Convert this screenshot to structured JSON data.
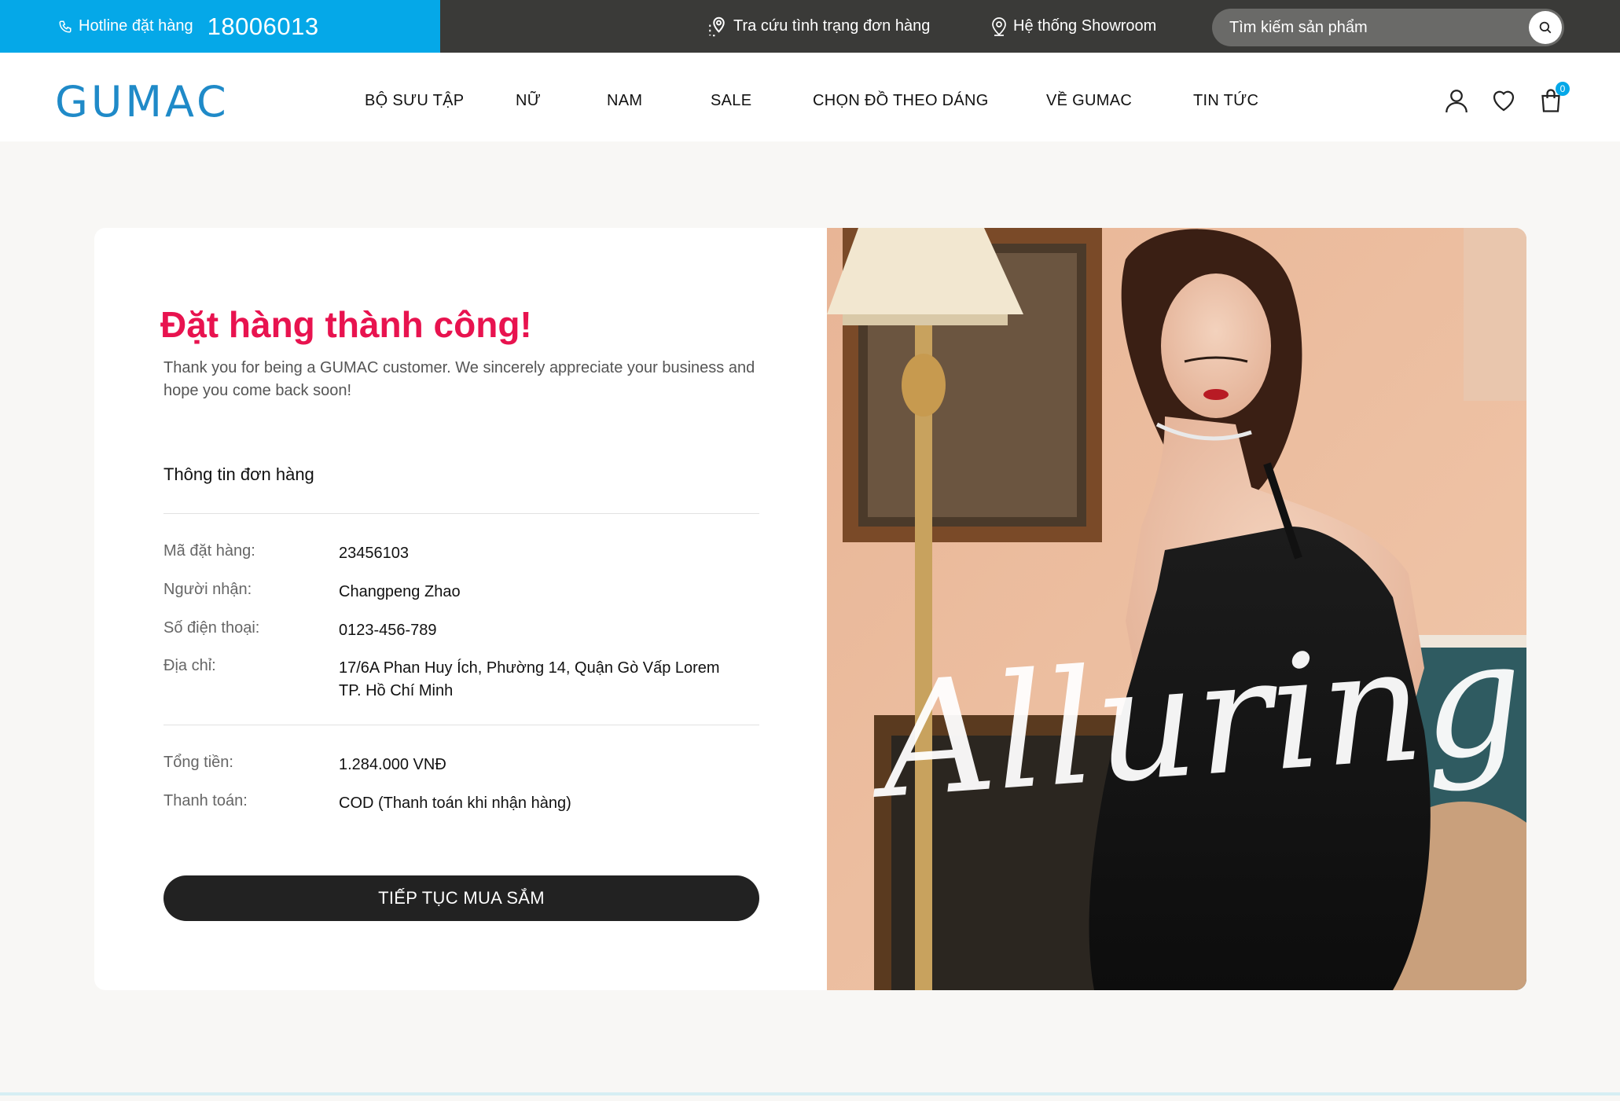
{
  "topbar": {
    "hotline_label": "Hotline đặt hàng",
    "hotline_number": "18006013",
    "track_order": "Tra cứu tình trạng đơn hàng",
    "showroom": "Hệ thống Showroom",
    "search_placeholder": "Tìm kiếm sản phẩm"
  },
  "header": {
    "logo": "GUMAC",
    "nav": [
      "BỘ SƯU TẬP",
      "NỮ",
      "NAM",
      "SALE",
      "CHỌN ĐỒ THEO DÁNG",
      "VỀ GUMAC",
      "TIN TỨC"
    ],
    "cart_count": "0"
  },
  "order": {
    "title": "Đặt hàng thành công!",
    "subtitle": "Thank you for being a GUMAC customer. We sincerely appreciate your business and hope you come back soon!",
    "section_title": "Thông tin đơn hàng",
    "fields": [
      {
        "label": "Mã đặt hàng:",
        "value": "23456103"
      },
      {
        "label": "Người nhận:",
        "value": "Changpeng Zhao"
      },
      {
        "label": "Số điện thoại:",
        "value": "0123-456-789"
      },
      {
        "label": "Địa chỉ:",
        "value": "17/6A Phan Huy Ích, Phường 14, Quận Gò Vấp Lorem TP. Hồ Chí Minh"
      }
    ],
    "totals": [
      {
        "label": "Tổng tiền:",
        "value": "1.284.000 VNĐ"
      },
      {
        "label": "Thanh toán:",
        "value": "COD (Thanh toán khi nhận hàng)"
      }
    ],
    "continue_button": "TIẾP TỤC MUA SẮM"
  },
  "banner": {
    "script_text": "Alluring."
  },
  "colors": {
    "accent_blue": "#05a8e8",
    "logo_blue": "#1f8ac8",
    "success_pink": "#e8134f",
    "button_dark": "#222222"
  }
}
